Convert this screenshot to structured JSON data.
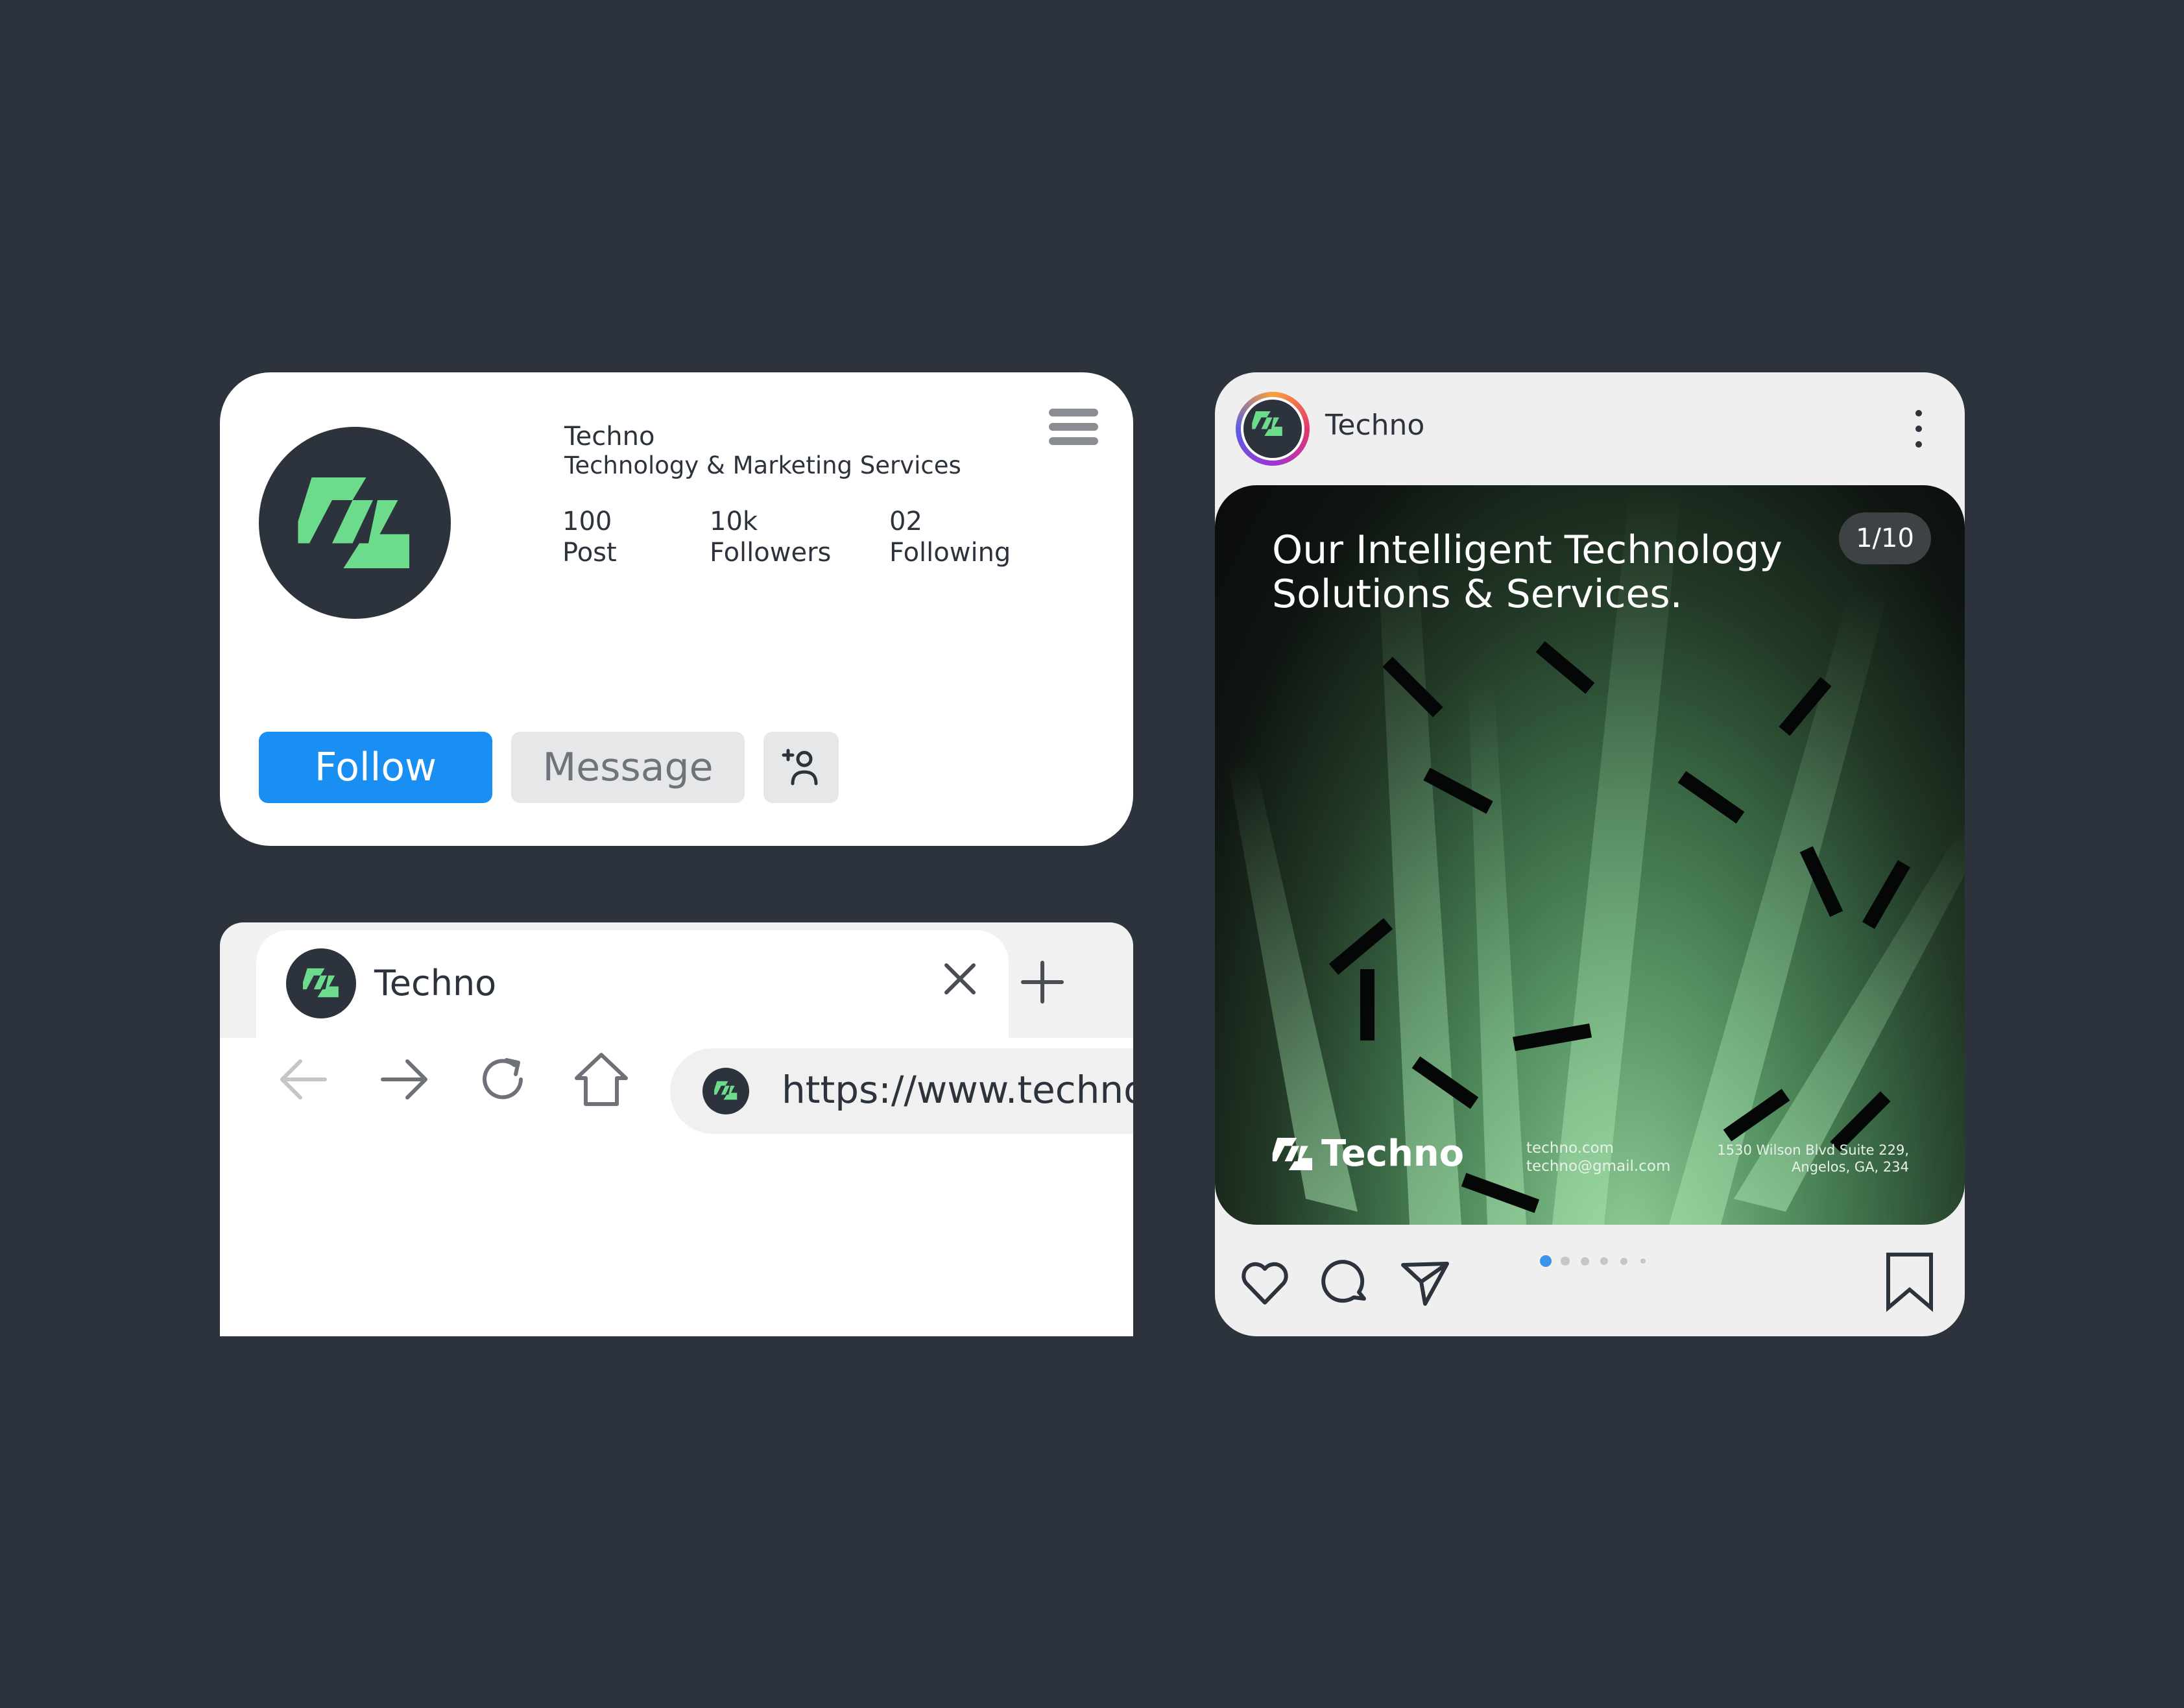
{
  "profile": {
    "name": "Techno",
    "tagline": "Technology & Marketing Services",
    "stats": [
      {
        "value": "100",
        "label": "Post"
      },
      {
        "value": "10k",
        "label": "Followers"
      },
      {
        "value": "02",
        "label": "Following"
      }
    ],
    "follow_label": "Follow",
    "message_label": "Message",
    "add_user_icon": "add-user-icon",
    "menu_icon": "hamburger-menu-icon"
  },
  "browser": {
    "tab_title": "Techno",
    "url": "https://www.techno",
    "nav_icons": [
      "arrow-left-icon",
      "arrow-right-icon",
      "reload-icon",
      "home-icon"
    ]
  },
  "post": {
    "username": "Techno",
    "headline_line1": "Our Intelligent Technology",
    "headline_line2": "Solutions & Services.",
    "counter": "1/10",
    "brand_name": "Techno",
    "website": "techno.com",
    "email": "techno@gmail.com",
    "address_line1": "1530 Wilson Blvd Suite 229,",
    "address_line2": "Angelos, GA, 234",
    "slide_dots": {
      "count": 6,
      "active_index": 0
    }
  },
  "colors": {
    "background": "#2d333c",
    "brand_green": "#6ddb8c",
    "follow_blue": "#1a8ff3",
    "dot_active": "#3b93ec"
  }
}
